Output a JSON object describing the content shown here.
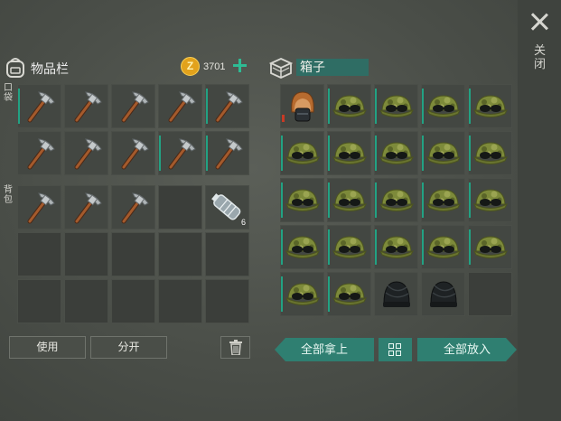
{
  "inventory": {
    "title": "物品栏",
    "coins": "3701",
    "pockets_label": "口袋",
    "backpack_label": "背包",
    "pockets": [
      {
        "item": "pickaxe-icon",
        "teal": true
      },
      {
        "item": "pickaxe-icon",
        "teal": false
      },
      {
        "item": "pickaxe-icon",
        "teal": false
      },
      {
        "item": "pickaxe-icon",
        "teal": false
      },
      {
        "item": "pickaxe-icon",
        "teal": true
      },
      {
        "item": "pickaxe-icon",
        "teal": false
      },
      {
        "item": "pickaxe-icon",
        "teal": false
      },
      {
        "item": "pickaxe-icon",
        "teal": false
      },
      {
        "item": "pickaxe-icon",
        "teal": true
      },
      {
        "item": "pickaxe-icon",
        "teal": true
      }
    ],
    "backpack": [
      {
        "item": "pickaxe-icon",
        "teal": false
      },
      {
        "item": "pickaxe-icon",
        "teal": false
      },
      {
        "item": "pickaxe-icon",
        "teal": false
      },
      {
        "item": "",
        "teal": false
      },
      {
        "item": "water-bottle-icon",
        "teal": false,
        "count": "6"
      },
      {
        "item": ""
      },
      {
        "item": ""
      },
      {
        "item": ""
      },
      {
        "item": ""
      },
      {
        "item": ""
      },
      {
        "item": ""
      },
      {
        "item": ""
      },
      {
        "item": ""
      },
      {
        "item": ""
      },
      {
        "item": ""
      }
    ]
  },
  "box": {
    "title": "箱子",
    "slots": [
      {
        "item": "helmet-icon",
        "teal": false,
        "red": true
      },
      {
        "item": "camo-cap-icon",
        "teal": true
      },
      {
        "item": "camo-cap-icon",
        "teal": true
      },
      {
        "item": "camo-cap-icon",
        "teal": true
      },
      {
        "item": "camo-cap-icon",
        "teal": true
      },
      {
        "item": "camo-cap-icon",
        "teal": true
      },
      {
        "item": "camo-cap-icon",
        "teal": true
      },
      {
        "item": "camo-cap-icon",
        "teal": true
      },
      {
        "item": "camo-cap-icon",
        "teal": true
      },
      {
        "item": "camo-cap-icon",
        "teal": true
      },
      {
        "item": "camo-cap-icon",
        "teal": true
      },
      {
        "item": "camo-cap-icon",
        "teal": true
      },
      {
        "item": "camo-cap-icon",
        "teal": true
      },
      {
        "item": "camo-cap-icon",
        "teal": true
      },
      {
        "item": "camo-cap-icon",
        "teal": true
      },
      {
        "item": "camo-cap-icon",
        "teal": true
      },
      {
        "item": "camo-cap-icon",
        "teal": true
      },
      {
        "item": "camo-cap-icon",
        "teal": true
      },
      {
        "item": "camo-cap-icon",
        "teal": true
      },
      {
        "item": "camo-cap-icon",
        "teal": true
      },
      {
        "item": "camo-cap-icon",
        "teal": true
      },
      {
        "item": "camo-cap-icon",
        "teal": true
      },
      {
        "item": "beanie-icon",
        "teal": false
      },
      {
        "item": "beanie-icon",
        "teal": false
      },
      {
        "item": "",
        "teal": false
      }
    ]
  },
  "buttons": {
    "use": "使用",
    "split": "分开",
    "take_all": "全部拿上",
    "put_all": "全部放入",
    "close": "关闭"
  },
  "colors": {
    "accent": "#2f7f71",
    "teal_marker": "#22a283",
    "coin": "#e2a21c",
    "plus": "#2ebb94"
  }
}
